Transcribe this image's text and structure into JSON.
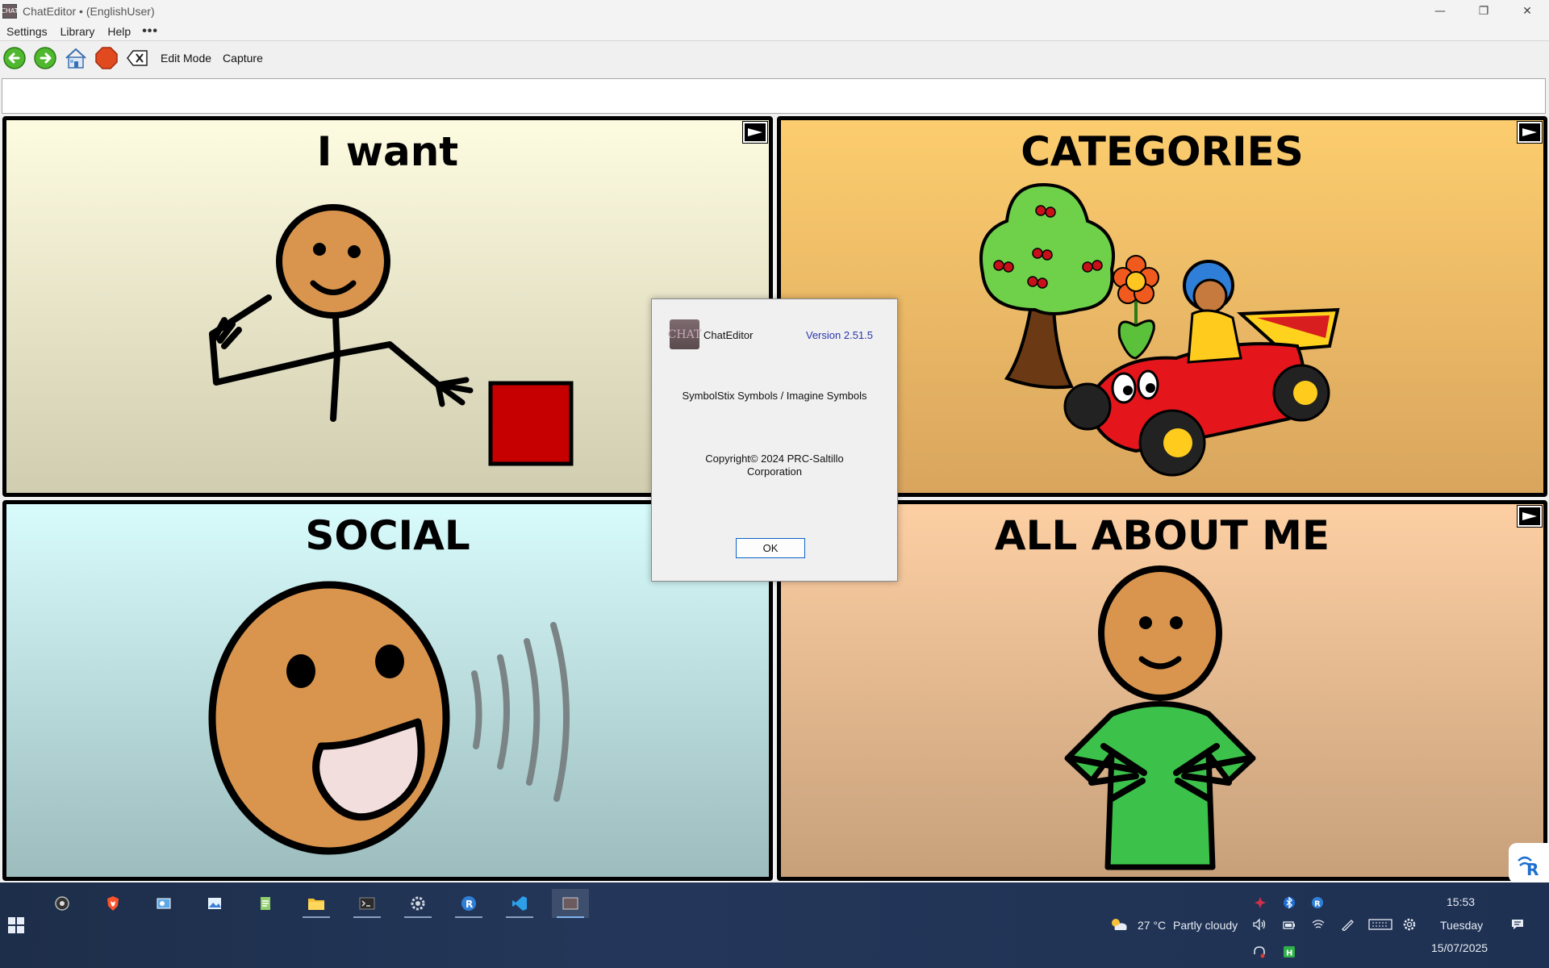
{
  "window": {
    "title": "ChatEditor • (EnglishUser)",
    "app_icon_text": "CHAT",
    "minimize": "—",
    "restore": "❐",
    "close": "✕"
  },
  "menu": {
    "items": [
      "Settings",
      "Library",
      "Help"
    ],
    "more": "•••"
  },
  "toolbar": {
    "edit_mode": "Edit Mode",
    "capture": "Capture"
  },
  "message_bar": {
    "value": ""
  },
  "cells": [
    {
      "label": "I want",
      "has_link": true,
      "background": "#fdfbe0"
    },
    {
      "label": "CATEGORIES",
      "has_link": true,
      "background": "#fccd6e"
    },
    {
      "label": "SOCIAL",
      "has_link": false,
      "background": "#d8fbfb"
    },
    {
      "label": "ALL ABOUT ME",
      "has_link": true,
      "background": "#fdcfa3"
    }
  ],
  "dialog": {
    "logo_text": "CHAT",
    "app_name": "ChatEditor",
    "version": "Version 2.51.5",
    "symbols": "SymbolStix Symbols / Imagine Symbols",
    "copyright": "Copyright© 2024 PRC-Saltillo Corporation",
    "ok": "OK"
  },
  "taskbar": {
    "weather_temp": "27 °C",
    "weather_text": "Partly cloudy",
    "time": "15:53",
    "day": "Tuesday",
    "date": "15/07/2025",
    "apps": [
      "obs-icon",
      "brave-icon",
      "control-panel-icon",
      "photos-icon",
      "notepad-icon",
      "file-explorer-icon",
      "terminal-icon",
      "settings-icon",
      "remote-icon",
      "vscode-icon",
      "chateditor-icon"
    ]
  },
  "colors": {
    "accent_blue": "#2a36b0",
    "ok_border": "#0a63c6",
    "taskbar": "#1d2e4a"
  }
}
